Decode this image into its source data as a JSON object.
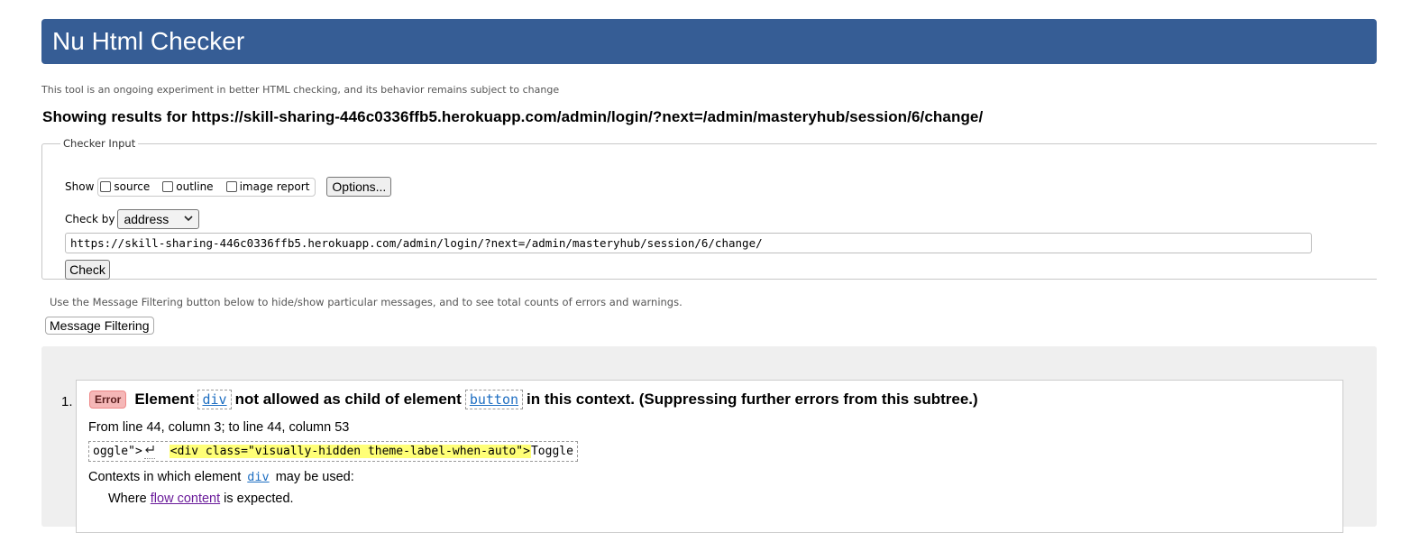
{
  "header": {
    "title": "Nu Html Checker"
  },
  "tagline": "This tool is an ongoing experiment in better HTML checking, and its behavior remains subject to change",
  "results_heading": {
    "prefix": "Showing results for",
    "url": "https://skill-sharing-446c0336ffb5.herokuapp.com/admin/login/?next=/admin/masteryhub/session/6/change/"
  },
  "checker_input": {
    "legend": "Checker Input",
    "show_label": "Show",
    "show_options": [
      {
        "label": "source",
        "checked": false
      },
      {
        "label": "outline",
        "checked": false
      },
      {
        "label": "image report",
        "checked": false
      }
    ],
    "options_button": "Options...",
    "check_by_label": "Check by",
    "check_by_value": "address",
    "url_value": "https://skill-sharing-446c0336ffb5.herokuapp.com/admin/login/?next=/admin/masteryhub/session/6/change/",
    "check_button": "Check"
  },
  "filter": {
    "note": "Use the Message Filtering button below to hide/show particular messages, and to see total counts of errors and warnings.",
    "button": "Message Filtering"
  },
  "messages": [
    {
      "number": "1.",
      "type": "Error",
      "text_before": "Element",
      "element": "div",
      "text_middle": "not allowed as child of element",
      "parent": "button",
      "text_after": "in this context. (Suppressing further errors from this subtree.)",
      "location": "From line 44, column 3; to line 44, column 53",
      "extract_before": "oggle\">",
      "extract_highlight": "<div class=\"visually-hidden theme-label-when-auto\">",
      "extract_after": "Toggle",
      "contexts_prefix": "Contexts in which element",
      "contexts_element": "div",
      "contexts_suffix": "may be used:",
      "where_prefix": "Where",
      "where_link": "flow content",
      "where_suffix": "is expected."
    }
  ],
  "colors": {
    "banner": "#365d95",
    "error_badge": "#f5b7b7",
    "highlight": "#ffff77"
  }
}
